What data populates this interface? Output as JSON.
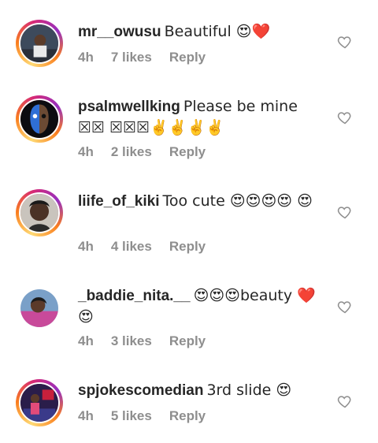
{
  "comments": [
    {
      "username": "mr__owusu",
      "text": "Beautiful 😍❤️",
      "time": "4h",
      "likes": "7 likes",
      "reply": "Reply"
    },
    {
      "username": "psalmwellking",
      "text": "Please be mine ☒☒ ☒☒☒✌️✌️✌️✌️",
      "time": "4h",
      "likes": "2 likes",
      "reply": "Reply"
    },
    {
      "username": "liife_of_kiki",
      "text": "Too cute 😍😍😍😍 😍",
      "time": "4h",
      "likes": "4 likes",
      "reply": "Reply"
    },
    {
      "username": "_baddie_nita.__",
      "text": "😍😍😍beauty ❤️😍",
      "time": "4h",
      "likes": "3 likes",
      "reply": "Reply"
    },
    {
      "username": "spjokescomedian",
      "text": "3rd slide 😍",
      "time": "4h",
      "likes": "5 likes",
      "reply": "Reply"
    }
  ]
}
